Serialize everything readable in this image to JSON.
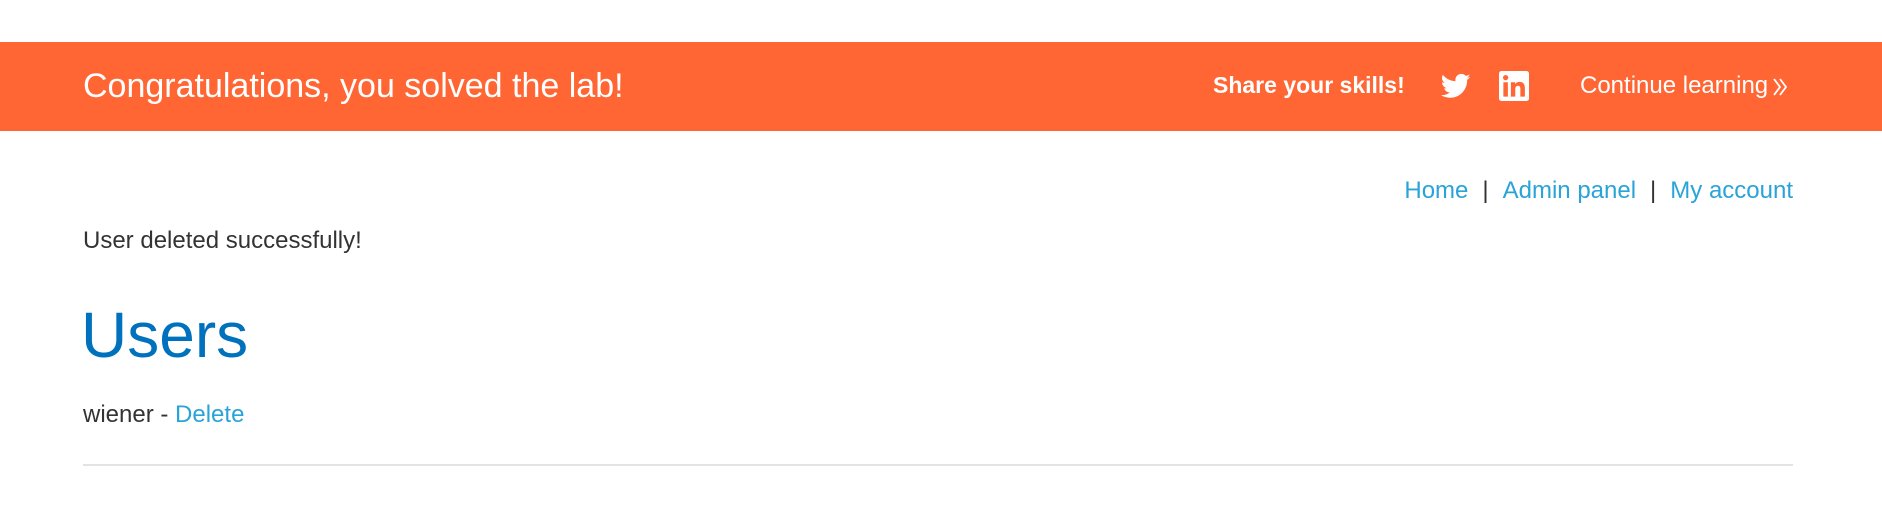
{
  "banner": {
    "title": "Congratulations, you solved the lab!",
    "share_label": "Share your skills!",
    "continue_label": "Continue learning",
    "icons": [
      "twitter-icon",
      "linkedin-icon",
      "chevron-double-right-icon"
    ],
    "background_color": "#ff6633"
  },
  "nav": {
    "home": "Home",
    "admin": "Admin panel",
    "account": "My account",
    "separator": "|"
  },
  "message": "User deleted successfully!",
  "heading": "Users",
  "users": [
    {
      "name": "wiener",
      "dash": "-",
      "action": "Delete"
    }
  ],
  "colors": {
    "link": "#29a3d8",
    "heading": "#0071bc",
    "text": "#333333"
  }
}
